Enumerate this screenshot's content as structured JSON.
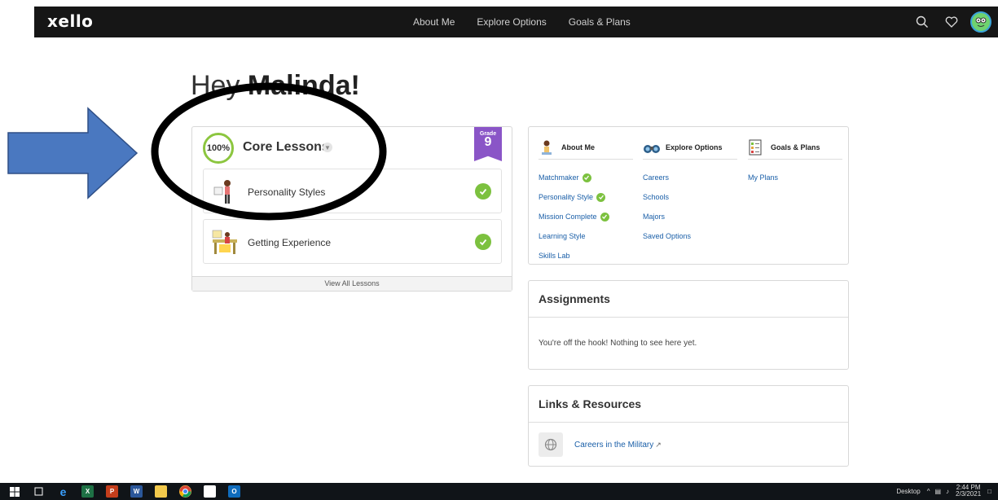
{
  "nav": {
    "logo": "xello",
    "links": [
      "About Me",
      "Explore Options",
      "Goals & Plans"
    ],
    "icons": [
      "search-icon",
      "heart-icon",
      "avatar"
    ]
  },
  "greeting": {
    "prefix": "Hey ",
    "name": "Malinda!"
  },
  "lessons": {
    "progress": "100%",
    "title": "Core Lessons",
    "grade_label": "Grade",
    "grade_number": "9",
    "items": [
      {
        "name": "Personality Styles",
        "completed": true
      },
      {
        "name": "Getting Experience",
        "completed": true
      }
    ],
    "view_all": "View All Lessons"
  },
  "sections": [
    {
      "title": "About Me",
      "icon": "student-icon",
      "links": [
        {
          "label": "Matchmaker",
          "done": true
        },
        {
          "label": "Personality Style",
          "done": true
        },
        {
          "label": "Mission Complete",
          "done": true
        },
        {
          "label": "Learning Style",
          "done": false
        },
        {
          "label": "Skills Lab",
          "done": false
        }
      ]
    },
    {
      "title": "Explore Options",
      "icon": "binoculars-icon",
      "links": [
        {
          "label": "Careers",
          "done": false
        },
        {
          "label": "Schools",
          "done": false
        },
        {
          "label": "Majors",
          "done": false
        },
        {
          "label": "Saved Options",
          "done": false
        }
      ]
    },
    {
      "title": "Goals & Plans",
      "icon": "checklist-icon",
      "links": [
        {
          "label": "My Plans",
          "done": false
        }
      ]
    }
  ],
  "assignments": {
    "title": "Assignments",
    "empty_text": "You're off the hook! Nothing to see here yet."
  },
  "resources": {
    "title": "Links & Resources",
    "items": [
      {
        "label": "Careers in the Military",
        "icon": "globe-icon",
        "external": true
      }
    ]
  },
  "taskbar": {
    "desktop_label": "Desktop",
    "time": "2:44 PM",
    "date": "2/3/2021"
  },
  "colors": {
    "nav_bg": "#161616",
    "accent_green": "#7cc13f",
    "grade_purple": "#8a55c7",
    "link_blue": "#1a5fa8",
    "arrow_blue": "#4a78c0"
  }
}
